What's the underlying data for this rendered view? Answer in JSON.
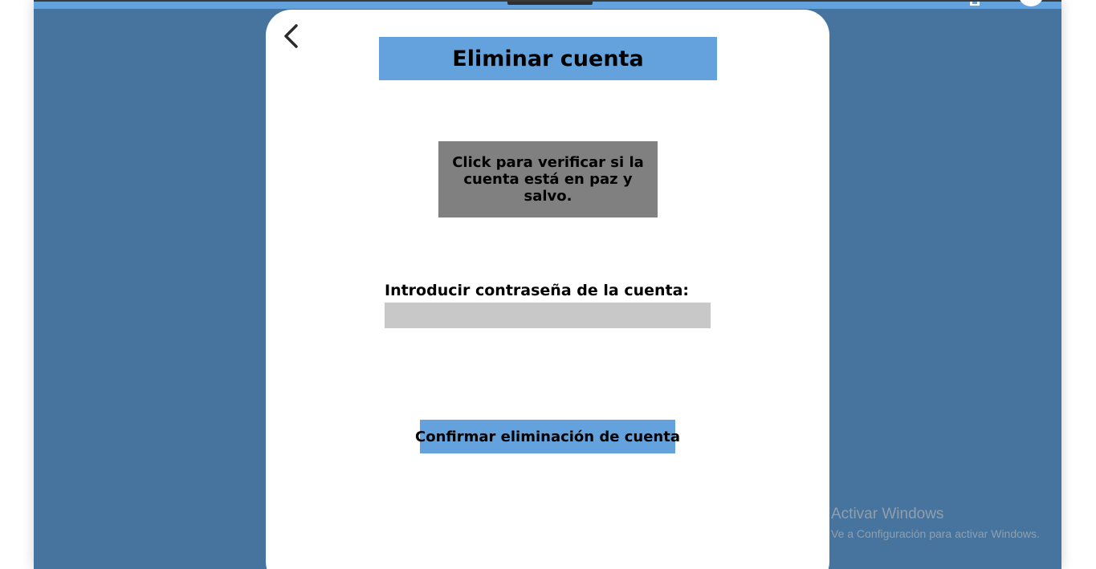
{
  "modal": {
    "title": "Eliminar cuenta",
    "verify_button_label": "Click para verificar si la cuenta está en paz y salvo.",
    "password_label": "Introducir contraseña de la cuenta:",
    "password_value": "",
    "confirm_button_label": "Confirmar eliminación de cuenta"
  },
  "watermark": {
    "title": "Activar Windows",
    "subtitle": "Ve a Configuración para activar Windows."
  },
  "icons": {
    "back": "chevron-left-icon",
    "cart": "cart-icon",
    "avatar": "user-avatar"
  },
  "colors": {
    "page_background": "#46749f",
    "accent": "#63a2dc",
    "verify_button": "#808080",
    "input_background": "#c8c8c8"
  }
}
